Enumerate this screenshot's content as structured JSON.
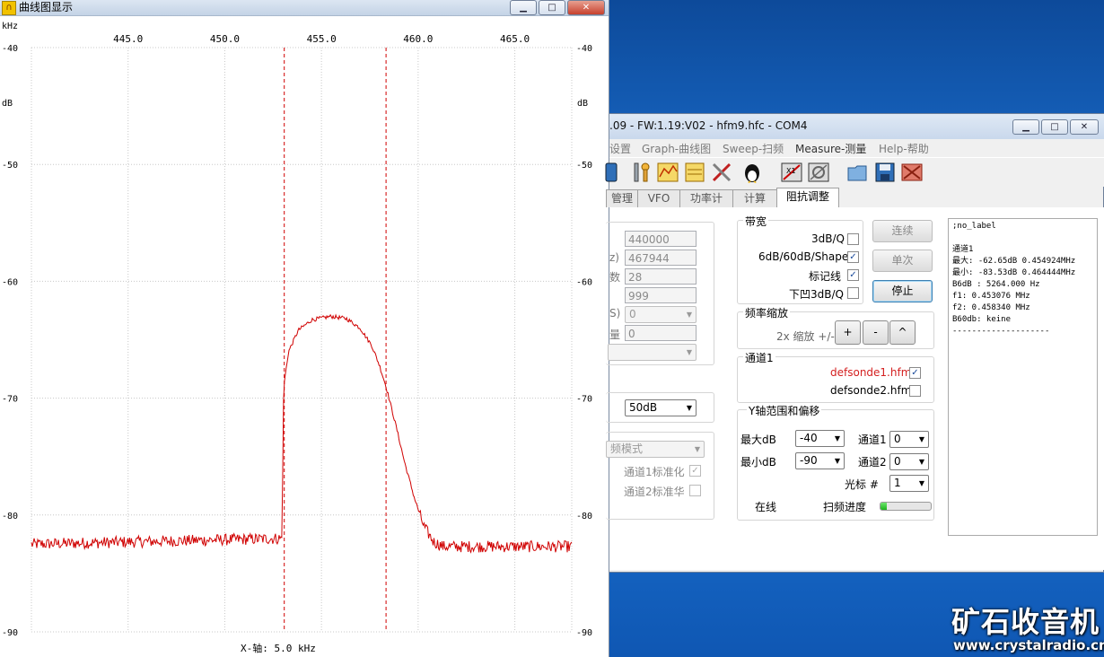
{
  "graph_window": {
    "title": "曲线图显示",
    "x_unit": "kHz",
    "y_unit": "dB",
    "x_axis_caption": "X-轴: 5.0 kHz"
  },
  "chart_data": {
    "type": "line",
    "x_ticks": [
      "445.0",
      "450.0",
      "455.0",
      "460.0",
      "465.0"
    ],
    "x_tick_values": [
      445,
      450,
      455,
      460,
      465
    ],
    "y_ticks": [
      "-40",
      "-50",
      "-60",
      "-70",
      "-80",
      "-90"
    ],
    "y_tick_values": [
      -40,
      -50,
      -60,
      -70,
      -80,
      -90
    ],
    "xlim": [
      440.0,
      467.944
    ],
    "ylim": [
      -90,
      -40
    ],
    "grid": true,
    "line_color": "#d00000",
    "marker_color": "#d00000",
    "markers_x_khz": [
      453.076,
      458.34
    ],
    "series": [
      {
        "x": [
          440.0,
          452.95,
          453.0,
          453.05,
          453.3,
          453.8,
          454.5,
          455.5,
          456.3,
          457.0,
          457.6,
          458.0,
          458.34,
          458.8,
          459.3,
          459.8,
          460.3,
          460.8,
          461.3,
          467.944
        ],
        "y": [
          -82.5,
          -82.0,
          -76.0,
          -69.0,
          -66.0,
          -64.2,
          -63.3,
          -63.0,
          -63.2,
          -64.0,
          -65.5,
          -67.2,
          -69.0,
          -72.0,
          -75.5,
          -78.5,
          -81.0,
          -82.3,
          -82.7,
          -82.7
        ]
      }
    ]
  },
  "app_window": {
    "title": ".09 - FW:1.19:V02 - hfm9.hfc - COM4",
    "menu": [
      "设置",
      "Graph-曲线图",
      "Sweep-扫频",
      "Measure-测量",
      "Help-帮助"
    ],
    "tabs": [
      "管理",
      "VFO",
      "功率计",
      "计算",
      "阻抗调整"
    ],
    "active_tab": "阻抗调整",
    "left_fields": {
      "start": "440000",
      "stop": "467944",
      "step_label": "z)",
      "step": "28",
      "count_label": "数",
      "count": "999",
      "mode_label": "S)",
      "mode": "0",
      "gain_label": "量",
      "gain": "0",
      "range": "50dB",
      "mode_select": "频模式",
      "norm1_label": "通道1标准化",
      "norm2_label": "通道2标准华"
    },
    "bandwidth": {
      "title": "带宽",
      "opt1": "3dB/Q",
      "opt2": "6dB/60dB/Shape",
      "opt3": "标记线",
      "opt4": "下凹3dB/Q"
    },
    "buttons": {
      "continuous": "连续",
      "single": "单次",
      "stop": "停止"
    },
    "zoom": {
      "title": "频率缩放",
      "label": "2x 缩放 +/-",
      "plus": "+",
      "minus": "-",
      "reset": "^"
    },
    "channel": {
      "title": "通道1",
      "file1": "defsonde1.hfm",
      "file2": "defsonde2.hfm",
      "file1_color": "#d42020"
    },
    "yaxis": {
      "title": "Y轴范围和偏移",
      "max_label": "最大dB",
      "max": "-40",
      "min_label": "最小dB",
      "min": "-90",
      "ch1_label": "通道1",
      "ch1": "0",
      "ch2_label": "通道2",
      "ch2": "0",
      "cursor_label": "光标 #",
      "cursor": "1",
      "online": "在线",
      "progress_label": "扫频进度",
      "progress": 0.12
    },
    "log_lines": [
      ";no_label",
      "",
      "通道1",
      "最大: -62.65dB 0.454924MHz",
      "最小: -83.53dB 0.464444MHz",
      "B6dB : 5264.000 Hz",
      "f1: 0.453076 MHz",
      "f2: 0.458340 MHz",
      "B60db: keine",
      "--------------------"
    ]
  },
  "watermark": {
    "brand": "矿石收音机",
    "url": "www.crystalradio.cn"
  }
}
